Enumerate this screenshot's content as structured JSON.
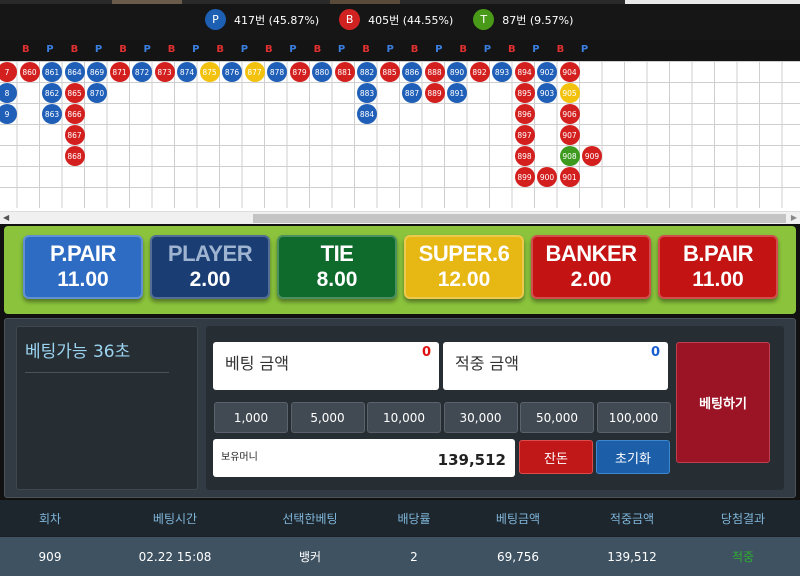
{
  "stats": [
    {
      "label": "P",
      "text": "417번 (45.87%)",
      "color": "#1d5fb3"
    },
    {
      "label": "B",
      "text": "405번 (44.55%)",
      "color": "#d12222"
    },
    {
      "label": "T",
      "text": "87번 (9.57%)",
      "color": "#4a9a1a"
    }
  ],
  "road_header": [
    "B",
    "P",
    "B",
    "P",
    "B",
    "P",
    "B",
    "P",
    "B",
    "P",
    "B",
    "P",
    "B",
    "P",
    "B",
    "P",
    "B",
    "P",
    "B",
    "P",
    "B",
    "P",
    "B",
    "P"
  ],
  "beads": [
    {
      "n": "7",
      "t": "B",
      "c": 0,
      "r": 0
    },
    {
      "n": "860",
      "t": "B",
      "c": 1,
      "r": 0
    },
    {
      "n": "861",
      "t": "P",
      "c": 2,
      "r": 0
    },
    {
      "n": "864",
      "t": "P",
      "c": 3,
      "r": 0
    },
    {
      "n": "869",
      "t": "P",
      "c": 4,
      "r": 0
    },
    {
      "n": "871",
      "t": "B",
      "c": 5,
      "r": 0
    },
    {
      "n": "872",
      "t": "P",
      "c": 6,
      "r": 0
    },
    {
      "n": "873",
      "t": "B",
      "c": 7,
      "r": 0
    },
    {
      "n": "874",
      "t": "P",
      "c": 8,
      "r": 0
    },
    {
      "n": "875",
      "t": "T",
      "c": 9,
      "r": 0
    },
    {
      "n": "876",
      "t": "P",
      "c": 10,
      "r": 0
    },
    {
      "n": "877",
      "t": "T",
      "c": 11,
      "r": 0
    },
    {
      "n": "878",
      "t": "P",
      "c": 12,
      "r": 0
    },
    {
      "n": "879",
      "t": "B",
      "c": 13,
      "r": 0
    },
    {
      "n": "880",
      "t": "P",
      "c": 14,
      "r": 0
    },
    {
      "n": "881",
      "t": "B",
      "c": 15,
      "r": 0
    },
    {
      "n": "882",
      "t": "P",
      "c": 16,
      "r": 0
    },
    {
      "n": "885",
      "t": "B",
      "c": 17,
      "r": 0
    },
    {
      "n": "886",
      "t": "P",
      "c": 18,
      "r": 0
    },
    {
      "n": "888",
      "t": "B",
      "c": 19,
      "r": 0
    },
    {
      "n": "890",
      "t": "P",
      "c": 20,
      "r": 0
    },
    {
      "n": "892",
      "t": "B",
      "c": 21,
      "r": 0
    },
    {
      "n": "893",
      "t": "P",
      "c": 22,
      "r": 0
    },
    {
      "n": "894",
      "t": "B",
      "c": 23,
      "r": 0
    },
    {
      "n": "902",
      "t": "P",
      "c": 24,
      "r": 0
    },
    {
      "n": "904",
      "t": "B",
      "c": 25,
      "r": 0
    },
    {
      "n": "8",
      "t": "P",
      "c": 0,
      "r": 1
    },
    {
      "n": "862",
      "t": "P",
      "c": 2,
      "r": 1
    },
    {
      "n": "865",
      "t": "B",
      "c": 3,
      "r": 1
    },
    {
      "n": "870",
      "t": "P",
      "c": 4,
      "r": 1
    },
    {
      "n": "883",
      "t": "P",
      "c": 16,
      "r": 1
    },
    {
      "n": "887",
      "t": "P",
      "c": 18,
      "r": 1
    },
    {
      "n": "889",
      "t": "B",
      "c": 19,
      "r": 1
    },
    {
      "n": "891",
      "t": "P",
      "c": 20,
      "r": 1
    },
    {
      "n": "895",
      "t": "B",
      "c": 23,
      "r": 1
    },
    {
      "n": "903",
      "t": "P",
      "c": 24,
      "r": 1
    },
    {
      "n": "905",
      "t": "T",
      "c": 25,
      "r": 1
    },
    {
      "n": "9",
      "t": "P",
      "c": 0,
      "r": 2
    },
    {
      "n": "863",
      "t": "P",
      "c": 2,
      "r": 2
    },
    {
      "n": "866",
      "t": "B",
      "c": 3,
      "r": 2
    },
    {
      "n": "884",
      "t": "P",
      "c": 16,
      "r": 2
    },
    {
      "n": "896",
      "t": "B",
      "c": 23,
      "r": 2
    },
    {
      "n": "906",
      "t": "B",
      "c": 25,
      "r": 2
    },
    {
      "n": "867",
      "t": "B",
      "c": 3,
      "r": 3
    },
    {
      "n": "897",
      "t": "B",
      "c": 23,
      "r": 3
    },
    {
      "n": "907",
      "t": "B",
      "c": 25,
      "r": 3
    },
    {
      "n": "868",
      "t": "B",
      "c": 3,
      "r": 4
    },
    {
      "n": "898",
      "t": "B",
      "c": 23,
      "r": 4
    },
    {
      "n": "908",
      "t": "G",
      "c": 25,
      "r": 4
    },
    {
      "n": "909",
      "t": "B",
      "c": 26,
      "r": 4
    },
    {
      "n": "899",
      "t": "B",
      "c": 23,
      "r": 5
    },
    {
      "n": "900",
      "t": "B",
      "c": 24,
      "r": 5
    },
    {
      "n": "901",
      "t": "B",
      "c": 25,
      "r": 5
    }
  ],
  "bead_colors": {
    "B": "#d41f1f",
    "P": "#1f5fb8",
    "T": "#f2c20e",
    "G": "#3d9a1f"
  },
  "bet_options": [
    {
      "name": "P.PAIR",
      "odds": "11.00",
      "bg": "#2e6cc4",
      "fg": "#ffffff"
    },
    {
      "name": "PLAYER",
      "odds": "2.00",
      "bg": "#1a3d73",
      "fg": "#9eb4d0"
    },
    {
      "name": "TIE",
      "odds": "8.00",
      "bg": "#0f6b2c",
      "fg": "#ffffff"
    },
    {
      "name": "SUPER.6",
      "odds": "12.00",
      "bg": "#e7b713",
      "fg": "#ffffff"
    },
    {
      "name": "BANKER",
      "odds": "2.00",
      "bg": "#c31313",
      "fg": "#ffffff"
    },
    {
      "name": "B.PAIR",
      "odds": "11.00",
      "bg": "#c31313",
      "fg": "#ffffff"
    }
  ],
  "timer_text": "베팅가능 36초",
  "bet_amount": {
    "label": "베팅 금액",
    "value": "0"
  },
  "win_amount": {
    "label": "적중 금액",
    "value": "0"
  },
  "chips": [
    "1,000",
    "5,000",
    "10,000",
    "30,000",
    "50,000",
    "100,000"
  ],
  "holding": {
    "label": "보유머니",
    "value": "139,512"
  },
  "buttons": {
    "change": "잔돈",
    "reset": "초기화",
    "bet": "베팅하기"
  },
  "history": {
    "headers": [
      "회차",
      "베팅시간",
      "선택한베팅",
      "배당률",
      "베팅금액",
      "적중금액",
      "당첨결과"
    ],
    "rows": [
      [
        "909",
        "02.22 15:08",
        "뱅커",
        "2",
        "69,756",
        "139,512",
        "적중"
      ]
    ]
  }
}
